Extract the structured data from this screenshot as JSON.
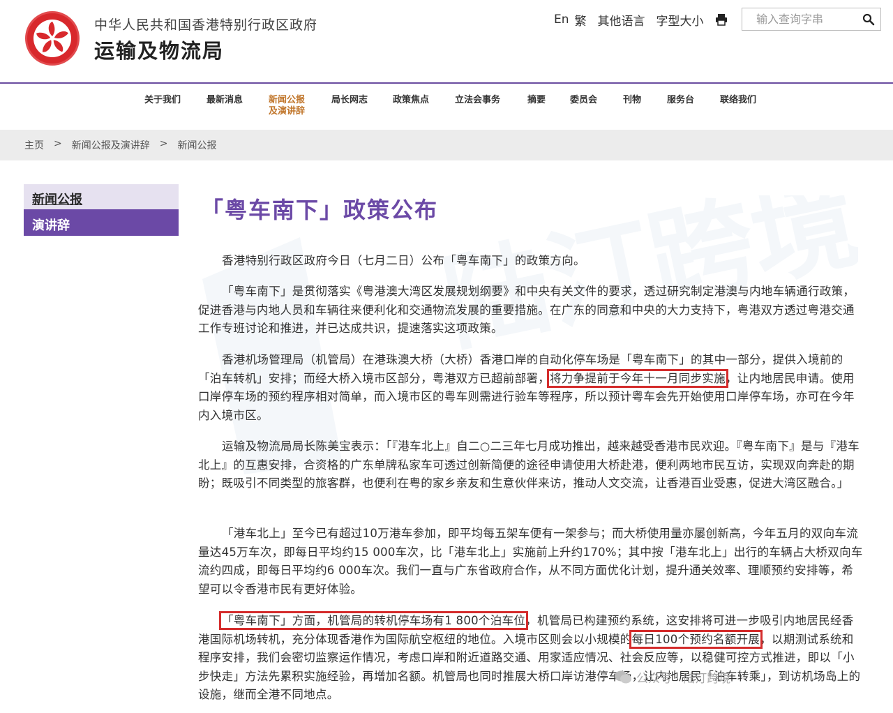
{
  "header": {
    "gov_name": "中华人民共和国香港特别行政区政府",
    "bureau_name": "运输及物流局",
    "lang_en": "En",
    "lang_tc": "繁",
    "other_lang": "其他语言",
    "font_size": "字型大小",
    "search_placeholder": "输入查询字串"
  },
  "nav": {
    "items": [
      "关于我们",
      "最新消息",
      "新闻公报\n及演讲辞",
      "局长网志",
      "政策焦点",
      "立法会事务",
      "摘要",
      "委员会",
      "刊物",
      "服务台",
      "联络我们"
    ],
    "active_index": 2
  },
  "breadcrumb": {
    "home": "主页",
    "sep": ">",
    "level1": "新闻公报及演讲辞",
    "level2": "新闻公报"
  },
  "sidebar": {
    "news": "新闻公报",
    "speeches": "演讲辞"
  },
  "article": {
    "title": "「粤车南下」政策公布",
    "p1": "香港特别行政区政府今日（七月二日）公布「粤车南下」的政策方向。",
    "p2": "「粤车南下」是贯彻落实《粤港澳大湾区发展规划纲要》和中央有关文件的要求，透过研究制定港澳与内地车辆通行政策，促进香港与内地人员和车辆往来便利化和交通物流发展的重要措施。在广东的同意和中央的大力支持下，粤港双方透过粤港交通工作专班讨论和推进，并已达成共识，提速落实这项政策。",
    "p3a": "香港机场管理局（机管局）在港珠澳大桥（大桥）香港口岸的自动化停车场是「粤车南下」的其中一部分，提供入境前的「泊车转机」安排；而经大桥入境市区部分，粤港双方已超前部署，",
    "p3_hl": "将力争提前于今年十一月同步实施",
    "p3b": "，让内地居民申请。使用口岸停车场的预约程序相对简单，而入境市区的粤车则需进行验车等程序，所以预计粤车会先开始使用口岸停车场，亦可在今年内入境市区。",
    "p4": "运输及物流局局长陈美宝表示：「『港车北上』自二○二三年七月成功推出，越来越受香港市民欢迎。『粤车南下』是与『港车北上』的互惠安排，合资格的广东单牌私家车可透过创新简便的途径申请使用大桥赴港，便利两地市民互访，实现双向奔赴的期盼；既吸引不同类型的旅客群，也便利在粤的家乡亲友和生意伙伴来访，推动人文交流，让香港百业受惠，促进大湾区融合。」",
    "p5": "「港车北上」至今已有超过10万港车参加，即平均每五架车便有一架参与；而大桥使用量亦屡创新高，今年五月的双向车流量达45万车次，即每日平均约15 000车次，比「港车北上」实施前上升约170%；其中按「港车北上」出行的车辆占大桥双向车流约四成，即每日平均约6 000车次。我们一直与广东省政府合作，从不同方面优化计划，提升通关效率、理顺预约安排等，希望可以令香港市民有更好体验。",
    "p6_hl1": "「粤车南下」方面，机管局的转机停车场有1 800个泊车位",
    "p6a": "，机管局已构建预约系统，这安排将可进一步吸引内地居民经香港国际机场转机，充分体现香港作为国际航空枢纽的地位。入境市区则会以小规模的",
    "p6_hl2": "每日100个预约名额开展",
    "p6b": "，以期测试系统和程序安排，我们会密切监察运作情况，考虑口岸和附近道路交通、用家适应情况、社会反应等，以稳健可控方式推进，即以「小步快走」方法先累积实施经验，再增加名额。机管局也同时推展大桥口岸访港停车场，让内地居民「泊车转乘」，到访机场岛上的设施，继而全港不同地点。"
  },
  "watermark": {
    "account": "公众号 · 陆汀跨境"
  },
  "colors": {
    "purple": "#6b49a6",
    "active_nav": "#c0752a",
    "highlight_border": "#d42c2c",
    "logo_red": "#d8282c"
  }
}
